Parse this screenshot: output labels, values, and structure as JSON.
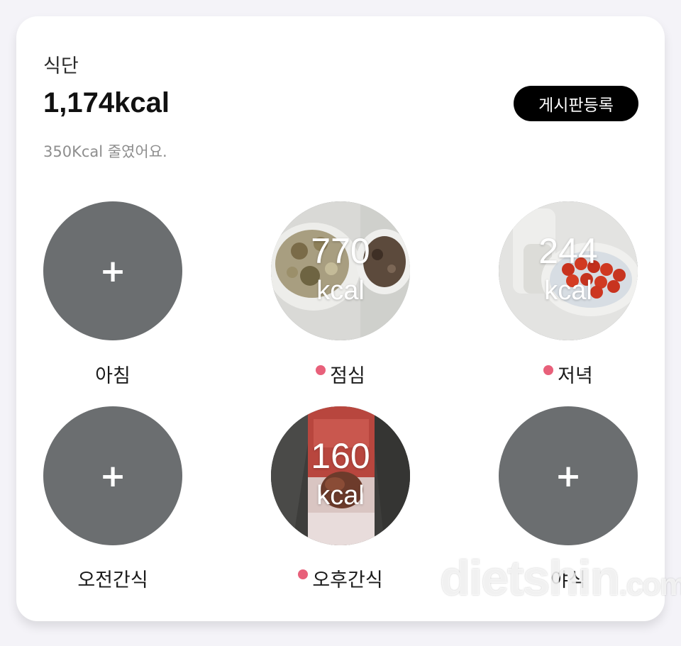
{
  "card": {
    "section_label": "식단",
    "total_kcal": "1,174kcal",
    "post_button": "게시판등록",
    "sub_text": "350Kcal 줄였어요."
  },
  "meals": [
    {
      "label": "아침",
      "add_icon": "+",
      "logged": false
    },
    {
      "label": "점심",
      "kcal_value": "770",
      "kcal_unit": "kcal",
      "logged": true
    },
    {
      "label": "저녁",
      "kcal_value": "244",
      "kcal_unit": "kcal",
      "logged": true
    },
    {
      "label": "오전간식",
      "add_icon": "+",
      "logged": false
    },
    {
      "label": "오후간식",
      "kcal_value": "160",
      "kcal_unit": "kcal",
      "logged": true
    },
    {
      "label": "야식",
      "add_icon": "+",
      "logged": false
    }
  ],
  "watermark": {
    "main": "dietshin",
    "suffix": ".com"
  },
  "colors": {
    "empty_circle": "#6b6e70",
    "dot": "#e8607a",
    "button_bg": "#000000"
  }
}
